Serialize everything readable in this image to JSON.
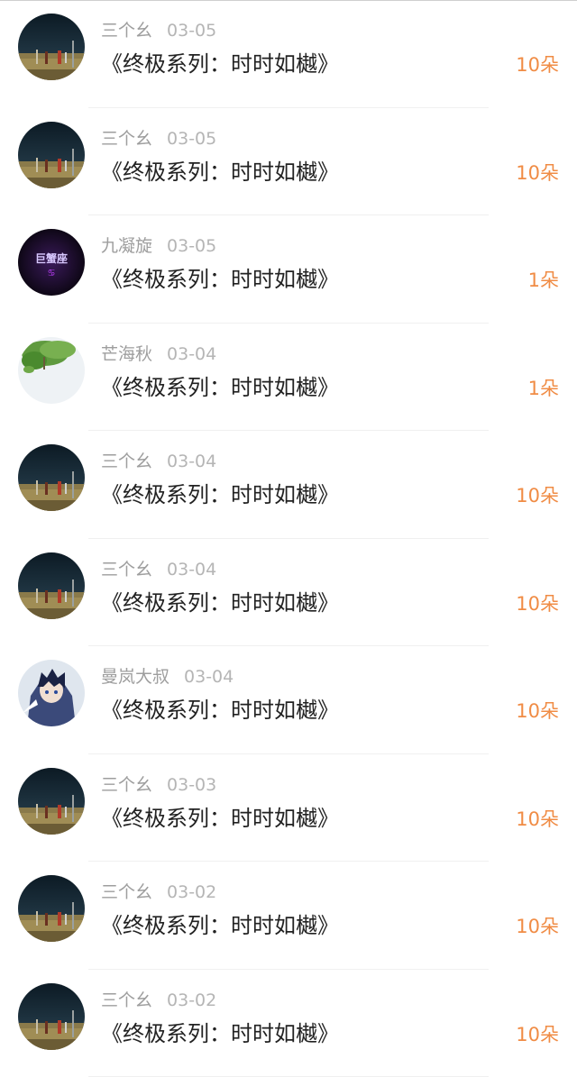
{
  "colors": {
    "username": "#9e9e9e",
    "date": "#b5b5b5",
    "gift_text": "#222222",
    "count": "#f08c45",
    "separator": "#f0f0f0"
  },
  "entries": [
    {
      "username": "三个幺",
      "date": "03-05",
      "gift": "《终极系列：时时如樾》",
      "count": "10朵",
      "avatar": "night-field"
    },
    {
      "username": "三个幺",
      "date": "03-05",
      "gift": "《终极系列：时时如樾》",
      "count": "10朵",
      "avatar": "night-field"
    },
    {
      "username": "九凝旋",
      "date": "03-05",
      "gift": "《终极系列：时时如樾》",
      "count": "1朵",
      "avatar": "cancer-sign"
    },
    {
      "username": "芒海秋",
      "date": "03-04",
      "gift": "《终极系列：时时如樾》",
      "count": "1朵",
      "avatar": "tree-leaves"
    },
    {
      "username": "三个幺",
      "date": "03-04",
      "gift": "《终极系列：时时如樾》",
      "count": "10朵",
      "avatar": "night-field"
    },
    {
      "username": "三个幺",
      "date": "03-04",
      "gift": "《终极系列：时时如樾》",
      "count": "10朵",
      "avatar": "night-field"
    },
    {
      "username": "曼岚大叔",
      "date": "03-04",
      "gift": "《终极系列：时时如樾》",
      "count": "10朵",
      "avatar": "anime-boy"
    },
    {
      "username": "三个幺",
      "date": "03-03",
      "gift": "《终极系列：时时如樾》",
      "count": "10朵",
      "avatar": "night-field"
    },
    {
      "username": "三个幺",
      "date": "03-02",
      "gift": "《终极系列：时时如樾》",
      "count": "10朵",
      "avatar": "night-field"
    },
    {
      "username": "三个幺",
      "date": "03-02",
      "gift": "《终极系列：时时如樾》",
      "count": "10朵",
      "avatar": "night-field"
    }
  ],
  "avatar_labels": {
    "cancer-sign": "巨蟹座"
  }
}
